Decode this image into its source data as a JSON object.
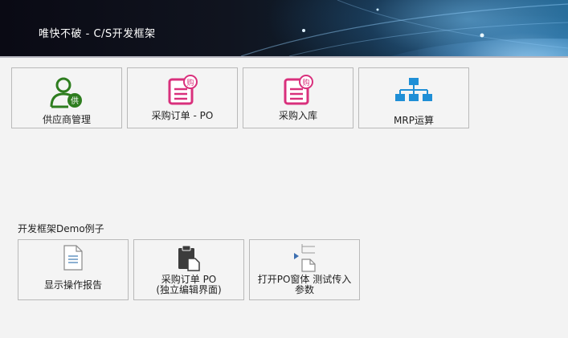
{
  "app": {
    "title": "唯快不破 - C/S开发框架"
  },
  "main_tiles": [
    {
      "label": "供应商管理",
      "icon": "supplier-icon"
    },
    {
      "label": "采购订单 - PO",
      "icon": "purchase-order-icon"
    },
    {
      "label": "采购入库",
      "icon": "purchase-receipt-icon"
    },
    {
      "label": "MRP运算",
      "icon": "org-chart-icon"
    }
  ],
  "demo_section": {
    "title": "开发框架Demo例子",
    "tiles": [
      {
        "label": "显示操作报告",
        "icon": "document-icon"
      },
      {
        "label_line1": "采购订单 PO",
        "label_line2": "(独立编辑界面)",
        "icon": "clipboard-icon"
      },
      {
        "label_line1": "打开PO窗体  测试传入",
        "label_line2": "参数",
        "icon": "send-document-icon"
      }
    ]
  },
  "colors": {
    "supplier_green": "#2e7d1f",
    "purchase_pink": "#d9307c",
    "mrp_blue": "#1f8fd6",
    "tile_border": "#b9b9b9"
  }
}
